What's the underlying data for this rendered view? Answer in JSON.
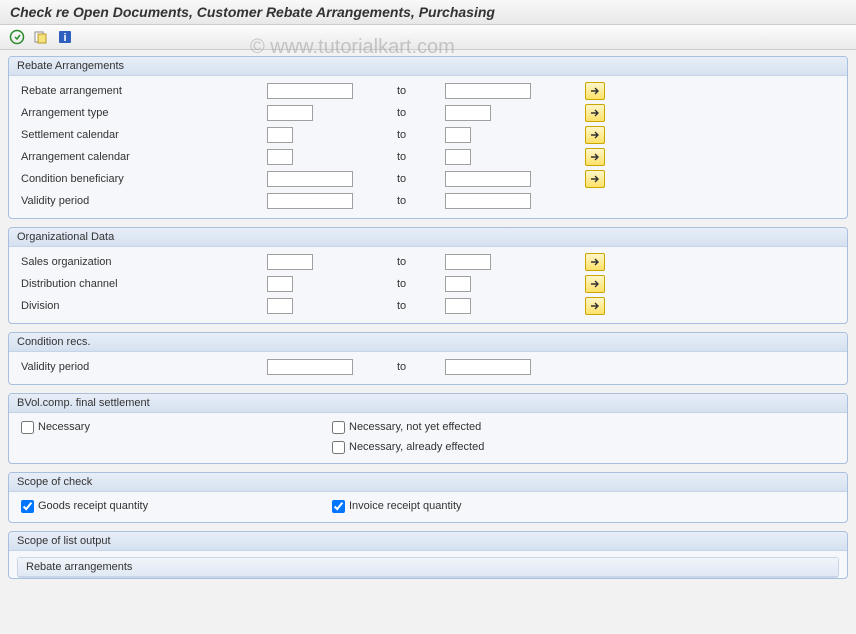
{
  "title": "Check re Open Documents, Customer Rebate Arrangements, Purchasing",
  "watermark": "© www.tutorialkart.com",
  "toolbar": {
    "execute_icon": "execute",
    "variant_icon": "variant",
    "help_icon": "help"
  },
  "to_label": "to",
  "groups": {
    "rebate": {
      "title": "Rebate Arrangements",
      "rows": [
        {
          "label": "Rebate arrangement",
          "size": "wide",
          "multi": true
        },
        {
          "label": "Arrangement type",
          "size": "med",
          "multi": true
        },
        {
          "label": "Settlement calendar",
          "size": "sm",
          "multi": true
        },
        {
          "label": "Arrangement calendar",
          "size": "sm",
          "multi": true
        },
        {
          "label": "Condition beneficiary",
          "size": "wide",
          "multi": true
        },
        {
          "label": "Validity period",
          "size": "wide",
          "multi": false
        }
      ]
    },
    "org": {
      "title": "Organizational Data",
      "rows": [
        {
          "label": "Sales organization",
          "size": "med",
          "multi": true
        },
        {
          "label": "Distribution channel",
          "size": "sm",
          "multi": true
        },
        {
          "label": "Division",
          "size": "sm",
          "multi": true
        }
      ]
    },
    "cond": {
      "title": "Condition recs.",
      "rows": [
        {
          "label": "Validity period",
          "size": "wide",
          "multi": false
        }
      ]
    },
    "bvol": {
      "title": "BVol.comp. final settlement",
      "checks": {
        "necessary": "Necessary",
        "not_effected": "Necessary, not yet effected",
        "already_effected": "Necessary, already effected"
      }
    },
    "scope_check": {
      "title": "Scope of check",
      "checks": {
        "goods": {
          "label": "Goods receipt quantity",
          "checked": true
        },
        "invoice": {
          "label": "Invoice receipt quantity",
          "checked": true
        }
      }
    },
    "scope_list": {
      "title": "Scope of list output",
      "sub": "Rebate arrangements"
    }
  }
}
